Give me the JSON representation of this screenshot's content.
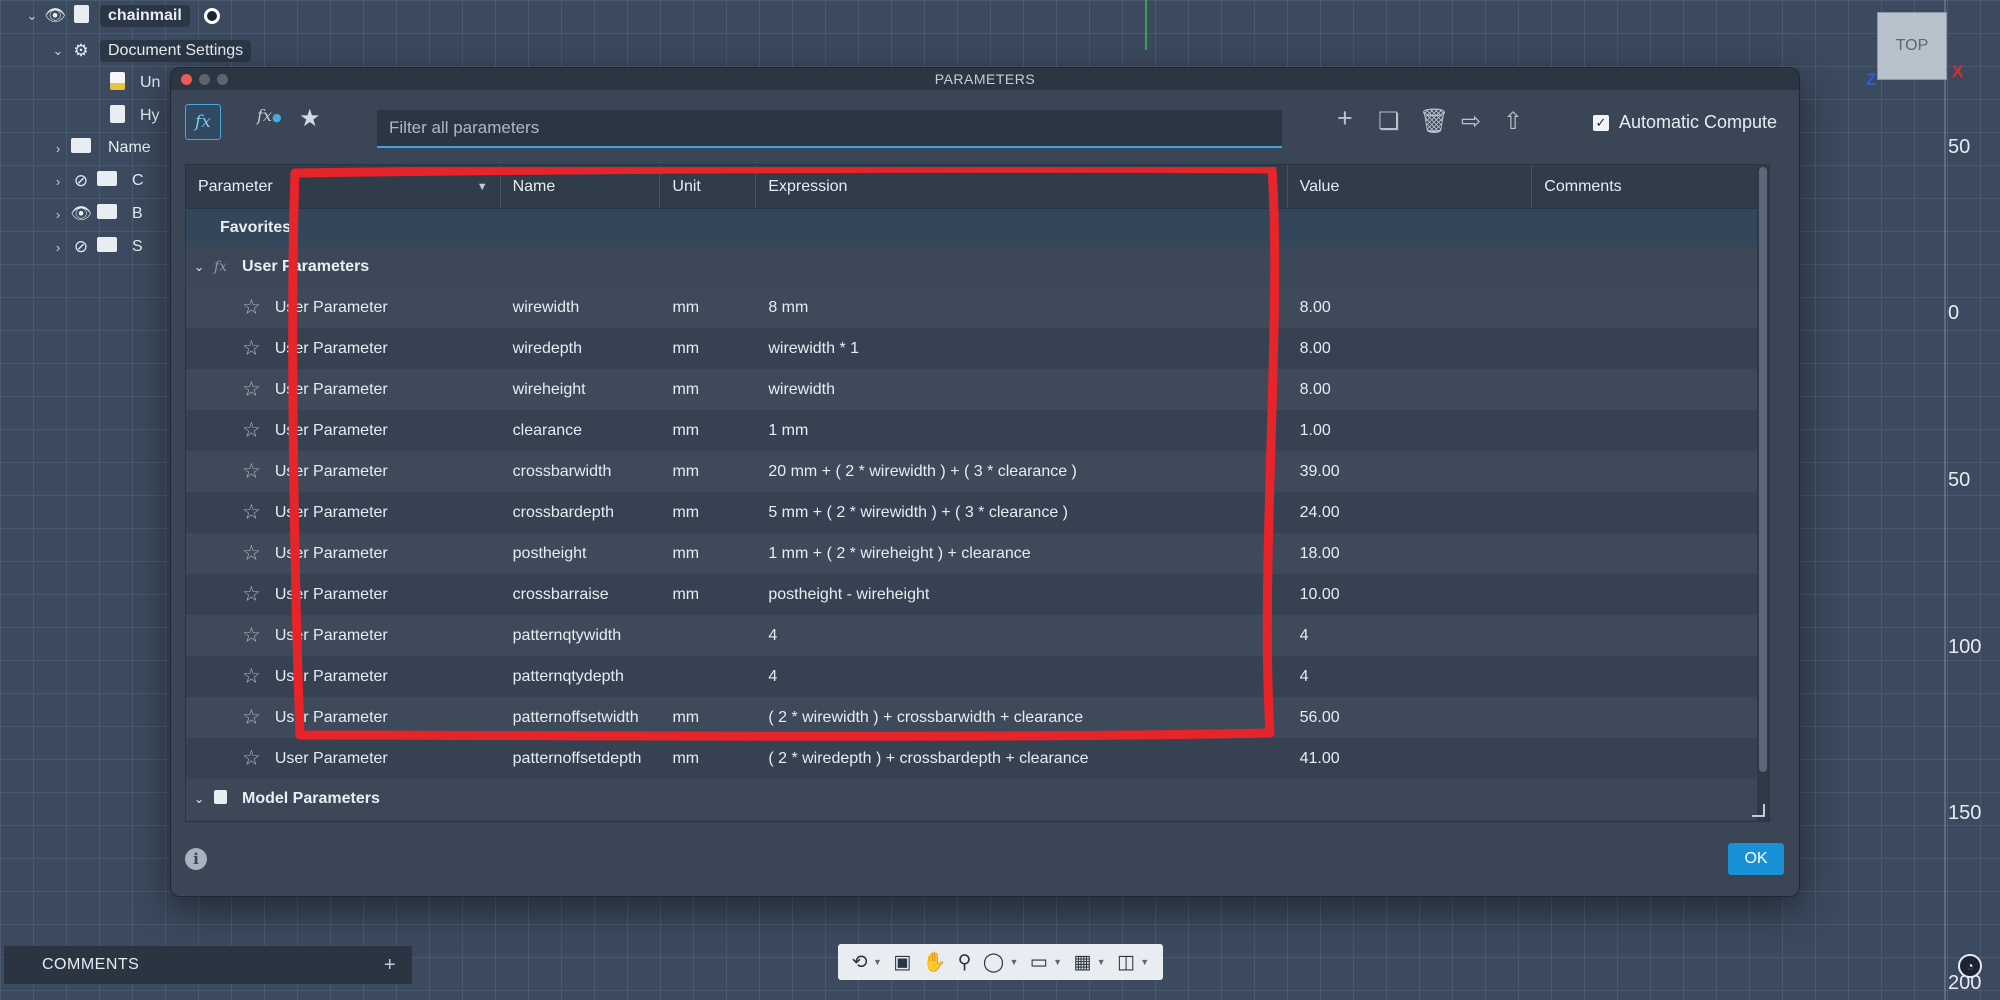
{
  "browser": {
    "root": "chainmail",
    "items": [
      {
        "label": "Document Settings"
      },
      {
        "label": "Un"
      },
      {
        "label": "Hy"
      },
      {
        "label": "Name"
      },
      {
        "label": "C"
      },
      {
        "label": "B"
      },
      {
        "label": "S"
      }
    ]
  },
  "viewcube": {
    "face": "TOP",
    "axis_z": "Z",
    "axis_x": "X"
  },
  "ruler": {
    "ticks": [
      "50",
      "0",
      "50",
      "100",
      "150",
      "200"
    ]
  },
  "dialog": {
    "title": "PARAMETERS",
    "fx_icon": "fx",
    "user_fx_icon": "fx",
    "filter_placeholder": "Filter all parameters",
    "automatic_compute_label": "Automatic Compute",
    "automatic_compute_checked": true,
    "ok_label": "OK",
    "icons": [
      "add-icon",
      "copy-icon",
      "delete-icon",
      "import-icon",
      "export-icon"
    ]
  },
  "table": {
    "headers": {
      "parameter": "Parameter",
      "name": "Name",
      "unit": "Unit",
      "expression": "Expression",
      "value": "Value",
      "comments": "Comments"
    },
    "favorites_label": "Favorites",
    "user_group_label": "User Parameters",
    "model_group_label": "Model Parameters",
    "rows": [
      {
        "type": "User Parameter",
        "name": "wirewidth",
        "unit": "mm",
        "expression": "8 mm",
        "value": "8.00"
      },
      {
        "type": "User Parameter",
        "name": "wiredepth",
        "unit": "mm",
        "expression": "wirewidth * 1",
        "value": "8.00"
      },
      {
        "type": "User Parameter",
        "name": "wireheight",
        "unit": "mm",
        "expression": "wirewidth",
        "value": "8.00"
      },
      {
        "type": "User Parameter",
        "name": "clearance",
        "unit": "mm",
        "expression": "1 mm",
        "value": "1.00"
      },
      {
        "type": "User Parameter",
        "name": "crossbarwidth",
        "unit": "mm",
        "expression": "20 mm + ( 2 * wirewidth ) + ( 3 * clearance )",
        "value": "39.00"
      },
      {
        "type": "User Parameter",
        "name": "crossbardepth",
        "unit": "mm",
        "expression": "5 mm + ( 2 * wirewidth ) + ( 3 * clearance )",
        "value": "24.00"
      },
      {
        "type": "User Parameter",
        "name": "postheight",
        "unit": "mm",
        "expression": "1 mm + ( 2 * wireheight ) + clearance",
        "value": "18.00"
      },
      {
        "type": "User Parameter",
        "name": "crossbarraise",
        "unit": "mm",
        "expression": "postheight - wireheight",
        "value": "10.00"
      },
      {
        "type": "User Parameter",
        "name": "patternqtywidth",
        "unit": "",
        "expression": "4",
        "value": "4"
      },
      {
        "type": "User Parameter",
        "name": "patternqtydepth",
        "unit": "",
        "expression": "4",
        "value": "4"
      },
      {
        "type": "User Parameter",
        "name": "patternoffsetwidth",
        "unit": "mm",
        "expression": "( 2 * wirewidth ) + crossbarwidth + clearance",
        "value": "56.00"
      },
      {
        "type": "User Parameter",
        "name": "patternoffsetdepth",
        "unit": "mm",
        "expression": "( 2 * wiredepth ) + crossbardepth + clearance",
        "value": "41.00"
      }
    ]
  },
  "comments_panel": {
    "label": "COMMENTS",
    "add": "+"
  },
  "annotation_color": "#e8242b",
  "accent_color": "#1991d6"
}
